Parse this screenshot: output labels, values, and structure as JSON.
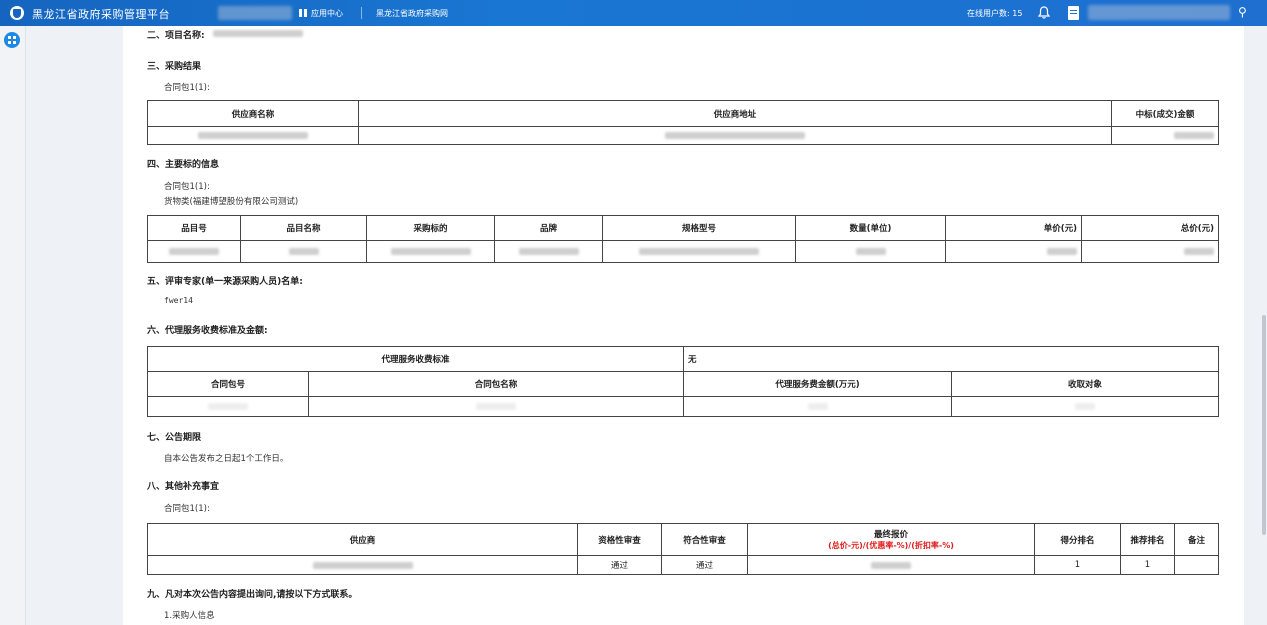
{
  "topbar": {
    "title": "黑龙江省政府采购管理平台",
    "app_center": "应用中心",
    "portal": "黑龙江省政府采购网",
    "online_label": "在线用户数:",
    "online_count": "15",
    "search_glyph": "⚲",
    "bg_color": "#1976d2"
  },
  "sections": {
    "s2_title": "二、项目名称:",
    "s3_title": "三、采购结果",
    "s3_pkg": "合同包1(1):",
    "s3_headers": [
      "供应商名称",
      "供应商地址",
      "中标(成交)金额"
    ],
    "s4_title": "四、主要标的信息",
    "s4_pkg": "合同包1(1):",
    "s4_sub": "货物类(福建博望股份有限公司测试)",
    "s4_headers": [
      "品目号",
      "品目名称",
      "采购标的",
      "品牌",
      "规格型号",
      "数量(单位)",
      "单价(元)",
      "总价(元)"
    ],
    "s5_title": "五、评审专家(单一来源采购人员)名单:",
    "s5_name": "fwer14",
    "s6_title": "六、代理服务收费标准及金额:",
    "s6_std_label": "代理服务收费标准",
    "s6_std_value": "无",
    "s6_headers": [
      "合同包号",
      "合同包名称",
      "代理服务费金额(万元)",
      "收取对象"
    ],
    "s7_title": "七、公告期限",
    "s7_text": "自本公告发布之日起1个工作日。",
    "s8_title": "八、其他补充事宜",
    "s8_pkg": "合同包1(1):",
    "s8_headers": [
      "供应商",
      "资格性审查",
      "符合性审查",
      "最终报价",
      "得分排名",
      "推荐排名",
      "备注"
    ],
    "s8_price_note": "(总价-元)/(优惠率-%)/(折扣率-%)",
    "s8_row": {
      "qual": "通过",
      "comp": "通过",
      "score_rank": "1",
      "rec_rank": "1"
    },
    "s9_title": "九、凡对本次公告内容提出询问,请按以下方式联系。",
    "s9_item1": "1.采购人信息"
  },
  "colors": {
    "accent_red": "#e01b1b"
  }
}
